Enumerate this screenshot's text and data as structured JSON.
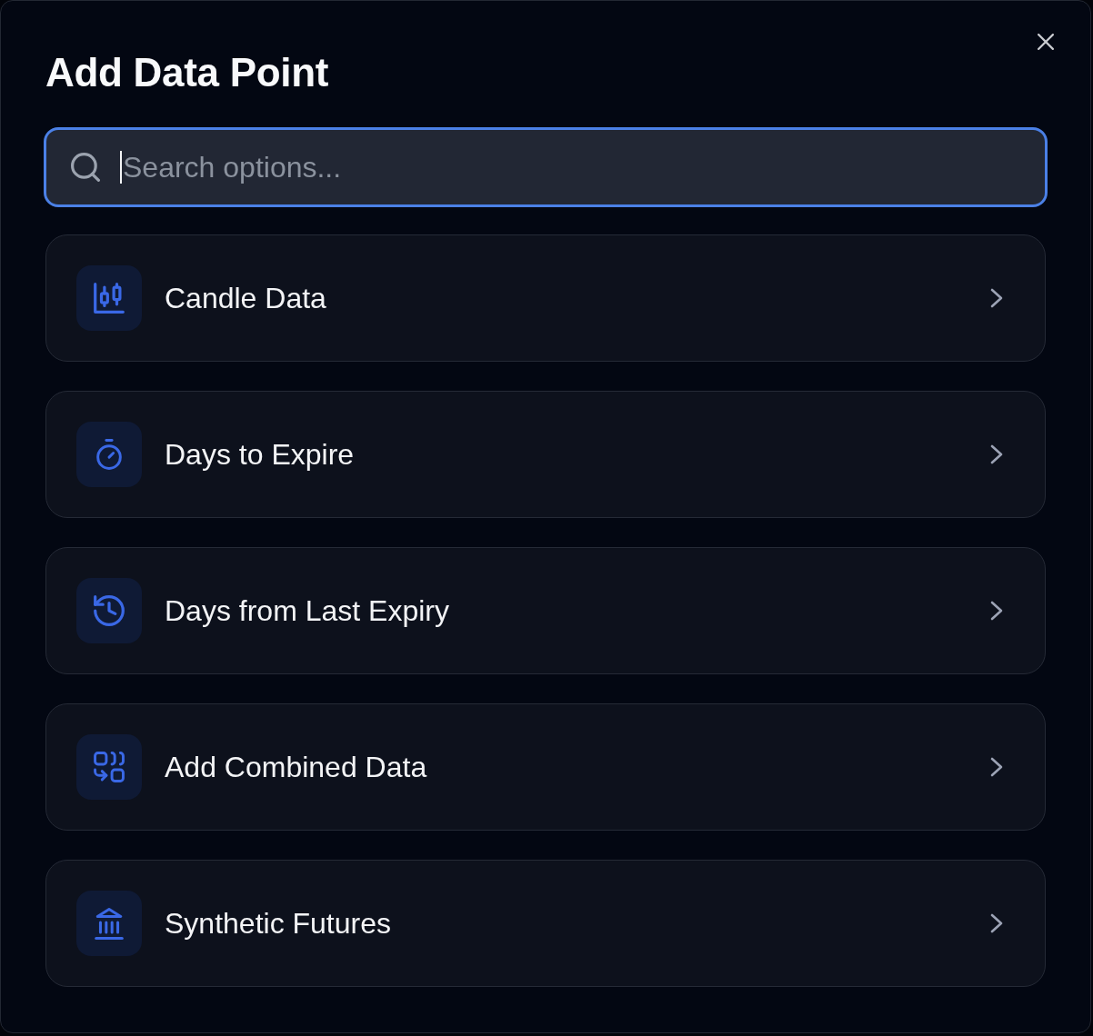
{
  "dialog": {
    "title": "Add Data Point"
  },
  "search": {
    "placeholder": "Search options...",
    "focused": true
  },
  "options": [
    {
      "kind": "candles",
      "label": "Candle Data"
    },
    {
      "kind": "timer",
      "label": "Days to Expire"
    },
    {
      "kind": "history",
      "label": "Days from Last Expiry"
    },
    {
      "kind": "combine",
      "label": "Add Combined Data"
    },
    {
      "kind": "institution",
      "label": "Synthetic Futures"
    }
  ]
}
